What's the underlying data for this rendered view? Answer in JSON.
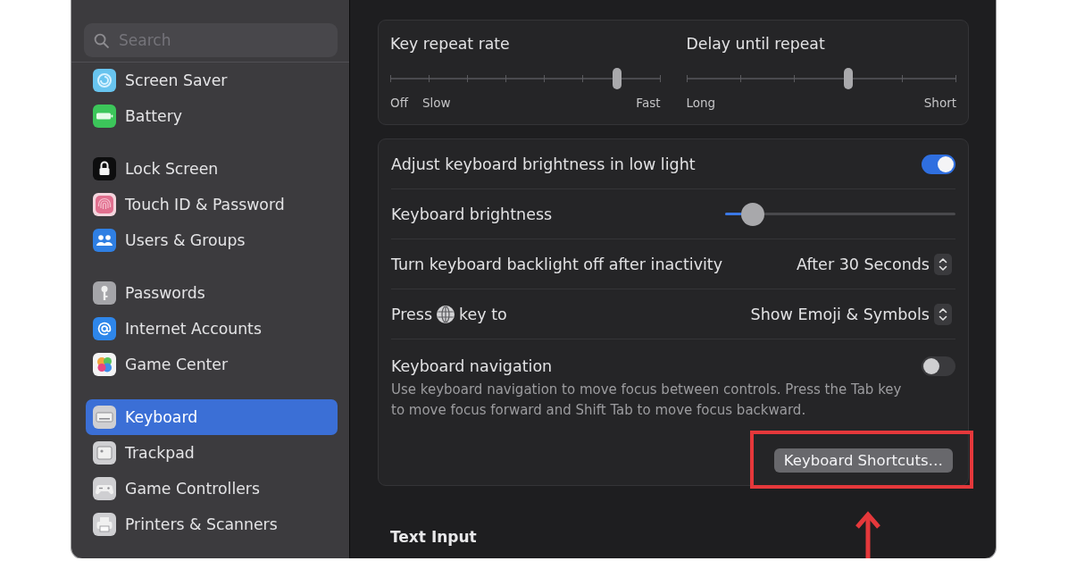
{
  "sidebar": {
    "search": {
      "placeholder": "Search"
    },
    "groups": [
      {
        "items": [
          {
            "label": "Screen Saver",
            "selected": false
          },
          {
            "label": "Battery",
            "selected": false
          }
        ]
      },
      {
        "items": [
          {
            "label": "Lock Screen",
            "selected": false
          },
          {
            "label": "Touch ID & Password",
            "selected": false
          },
          {
            "label": "Users & Groups",
            "selected": false
          }
        ]
      },
      {
        "items": [
          {
            "label": "Passwords",
            "selected": false
          },
          {
            "label": "Internet Accounts",
            "selected": false
          },
          {
            "label": "Game Center",
            "selected": false
          }
        ]
      },
      {
        "items": [
          {
            "label": "Keyboard",
            "selected": true
          },
          {
            "label": "Trackpad",
            "selected": false
          },
          {
            "label": "Game Controllers",
            "selected": false
          },
          {
            "label": "Printers & Scanners",
            "selected": false
          }
        ]
      }
    ]
  },
  "repeat_card": {
    "sliders": [
      {
        "label": "Key repeat rate",
        "level": 0.84,
        "marks": [
          "Off",
          "Slow",
          "Fast"
        ]
      },
      {
        "label": "Delay until repeat",
        "level": 0.6,
        "marks": [
          "Long",
          "Short"
        ]
      }
    ]
  },
  "settings": {
    "rows": [
      {
        "kind": "toggle",
        "label": "Adjust keyboard brightness in low light",
        "on": true
      },
      {
        "kind": "slider",
        "label": "Keyboard brightness",
        "level": 0.12
      },
      {
        "kind": "popup",
        "label": "Turn keyboard backlight off after inactivity",
        "value": "After 30 Seconds"
      },
      {
        "kind": "key_popup",
        "label": "Press",
        "label_after": "key to",
        "value": "Show Emoji & Symbols"
      },
      {
        "kind": "toggle",
        "label": "Keyboard navigation",
        "on": false,
        "description": "Use keyboard navigation to move focus between controls. Press the Tab key to move focus forward and Shift Tab to move focus backward."
      }
    ],
    "buttons": [
      {
        "label": "Keyboard Shortcuts…"
      }
    ]
  },
  "text_input": {
    "heading": "Text Input"
  }
}
